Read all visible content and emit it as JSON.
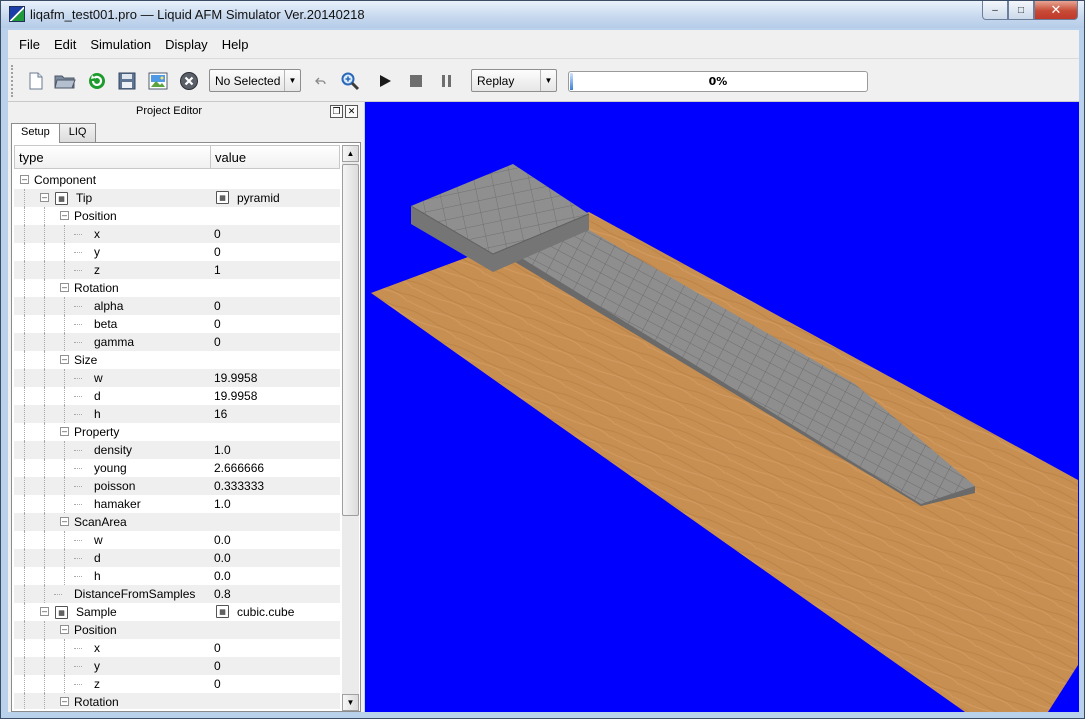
{
  "window": {
    "title": "liqafm_test001.pro — Liquid AFM Simulator Ver.20140218",
    "controls": [
      "–",
      "□",
      "✕"
    ]
  },
  "menu": [
    "File",
    "Edit",
    "Simulation",
    "Display",
    "Help"
  ],
  "toolbar": {
    "icons": [
      "new-file-icon",
      "open-folder-icon",
      "reload-icon",
      "save-icon",
      "image-icon",
      "stop-circle-icon",
      "undo-icon",
      "zoom-in-icon",
      "play-icon",
      "stop-icon",
      "pause-icon"
    ],
    "selection_combo": "No Selected",
    "mode_combo": "Replay",
    "progress": {
      "value": 0,
      "label": "0%"
    }
  },
  "dock": {
    "title": "Project Editor",
    "tabs": [
      "Setup",
      "LIQ"
    ],
    "columns": [
      "type",
      "value"
    ],
    "rows": [
      {
        "depth": 0,
        "type": "Component",
        "value": "",
        "expander": "⊟"
      },
      {
        "depth": 1,
        "type": "Tip",
        "value": "pyramid",
        "expander": "⊟",
        "icon": true,
        "value_icon": true
      },
      {
        "depth": 2,
        "type": "Position",
        "value": "",
        "expander": "⊟"
      },
      {
        "depth": 3,
        "type": "x",
        "value": "0"
      },
      {
        "depth": 3,
        "type": "y",
        "value": "0"
      },
      {
        "depth": 3,
        "type": "z",
        "value": "1"
      },
      {
        "depth": 2,
        "type": "Rotation",
        "value": "",
        "expander": "⊟"
      },
      {
        "depth": 3,
        "type": "alpha",
        "value": "0"
      },
      {
        "depth": 3,
        "type": "beta",
        "value": "0"
      },
      {
        "depth": 3,
        "type": "gamma",
        "value": "0"
      },
      {
        "depth": 2,
        "type": "Size",
        "value": "",
        "expander": "⊟"
      },
      {
        "depth": 3,
        "type": "w",
        "value": "19.9958"
      },
      {
        "depth": 3,
        "type": "d",
        "value": "19.9958"
      },
      {
        "depth": 3,
        "type": "h",
        "value": "16"
      },
      {
        "depth": 2,
        "type": "Property",
        "value": "",
        "expander": "⊟"
      },
      {
        "depth": 3,
        "type": "density",
        "value": "1.0"
      },
      {
        "depth": 3,
        "type": "young",
        "value": "2.666666"
      },
      {
        "depth": 3,
        "type": "poisson",
        "value": "0.333333"
      },
      {
        "depth": 3,
        "type": "hamaker",
        "value": "1.0"
      },
      {
        "depth": 2,
        "type": "ScanArea",
        "value": "",
        "expander": "⊟"
      },
      {
        "depth": 3,
        "type": "w",
        "value": "0.0"
      },
      {
        "depth": 3,
        "type": "d",
        "value": "0.0"
      },
      {
        "depth": 3,
        "type": "h",
        "value": "0.0"
      },
      {
        "depth": 2,
        "type": "DistanceFromSamples",
        "value": "0.8"
      },
      {
        "depth": 1,
        "type": "Sample",
        "value": "cubic.cube",
        "expander": "⊟",
        "icon": true,
        "value_icon": true
      },
      {
        "depth": 2,
        "type": "Position",
        "value": "",
        "expander": "⊟"
      },
      {
        "depth": 3,
        "type": "x",
        "value": "0"
      },
      {
        "depth": 3,
        "type": "y",
        "value": "0"
      },
      {
        "depth": 3,
        "type": "z",
        "value": "0"
      },
      {
        "depth": 2,
        "type": "Rotation",
        "value": "",
        "expander": "⊟"
      }
    ]
  },
  "view3d": {
    "background": "#0000ff",
    "floor_color": "#c88f52",
    "cube_color": "#8f8f8f"
  }
}
